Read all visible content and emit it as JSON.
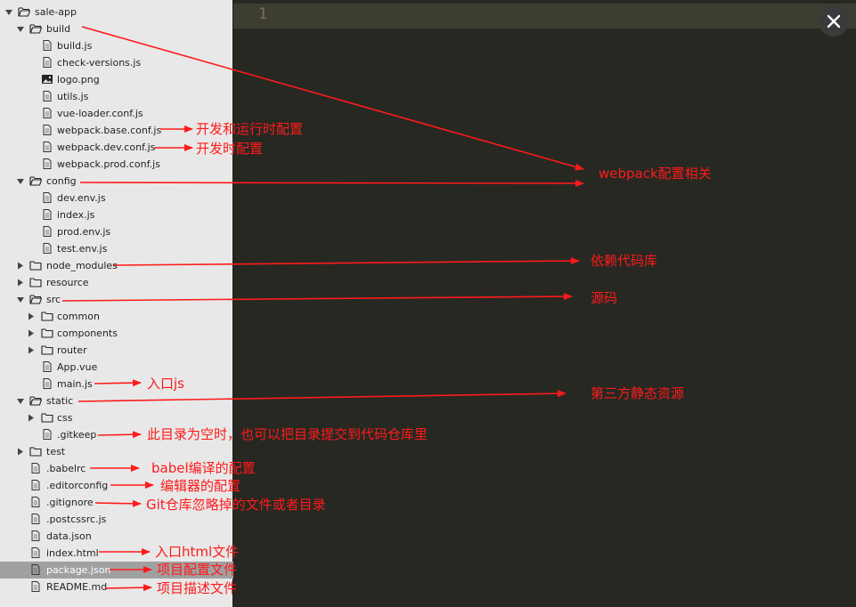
{
  "sidebar": {
    "rows": [
      {
        "label": "sale-app",
        "kind": "folder",
        "open": true,
        "depth": 0
      },
      {
        "label": "build",
        "kind": "folder",
        "open": true,
        "depth": 1
      },
      {
        "label": "build.js",
        "kind": "file",
        "depth": 2
      },
      {
        "label": "check-versions.js",
        "kind": "file",
        "depth": 2
      },
      {
        "label": "logo.png",
        "kind": "image",
        "depth": 2
      },
      {
        "label": "utils.js",
        "kind": "file",
        "depth": 2
      },
      {
        "label": "vue-loader.conf.js",
        "kind": "file",
        "depth": 2
      },
      {
        "label": "webpack.base.conf.js",
        "kind": "file",
        "depth": 2
      },
      {
        "label": "webpack.dev.conf.js",
        "kind": "file",
        "depth": 2
      },
      {
        "label": "webpack.prod.conf.js",
        "kind": "file",
        "depth": 2
      },
      {
        "label": "config",
        "kind": "folder",
        "open": true,
        "depth": 1
      },
      {
        "label": "dev.env.js",
        "kind": "file",
        "depth": 2
      },
      {
        "label": "index.js",
        "kind": "file",
        "depth": 2
      },
      {
        "label": "prod.env.js",
        "kind": "file",
        "depth": 2
      },
      {
        "label": "test.env.js",
        "kind": "file",
        "depth": 2
      },
      {
        "label": "node_modules",
        "kind": "folder",
        "open": false,
        "depth": 1
      },
      {
        "label": "resource",
        "kind": "folder",
        "open": false,
        "depth": 1
      },
      {
        "label": "src",
        "kind": "folder",
        "open": true,
        "depth": 1
      },
      {
        "label": "common",
        "kind": "folder",
        "open": false,
        "depth": 2
      },
      {
        "label": "components",
        "kind": "folder",
        "open": false,
        "depth": 2
      },
      {
        "label": "router",
        "kind": "folder",
        "open": false,
        "depth": 2
      },
      {
        "label": "App.vue",
        "kind": "file",
        "depth": 2
      },
      {
        "label": "main.js",
        "kind": "file",
        "depth": 2
      },
      {
        "label": "static",
        "kind": "folder",
        "open": true,
        "depth": 1
      },
      {
        "label": "css",
        "kind": "folder",
        "open": false,
        "depth": 2
      },
      {
        "label": ".gitkeep",
        "kind": "file",
        "depth": 2
      },
      {
        "label": "test",
        "kind": "folder",
        "open": false,
        "depth": 1
      },
      {
        "label": ".babelrc",
        "kind": "file",
        "depth": 1
      },
      {
        "label": ".editorconfig",
        "kind": "file",
        "depth": 1
      },
      {
        "label": ".gitignore",
        "kind": "file",
        "depth": 1
      },
      {
        "label": ".postcssrc.js",
        "kind": "file",
        "depth": 1
      },
      {
        "label": "data.json",
        "kind": "file",
        "depth": 1
      },
      {
        "label": "index.html",
        "kind": "file",
        "depth": 1
      },
      {
        "label": "package.json",
        "kind": "file",
        "depth": 1,
        "selected": true
      },
      {
        "label": "README.md",
        "kind": "file",
        "depth": 1
      }
    ]
  },
  "editor": {
    "line_number": "1",
    "close_icon": "close-icon"
  },
  "annotations": [
    {
      "id": "webpack-base",
      "text": "开发和运行时配置"
    },
    {
      "id": "webpack-dev",
      "text": "开发时配置"
    },
    {
      "id": "webpack",
      "text": "webpack配置相关"
    },
    {
      "id": "node-modules",
      "text": "依赖代码库"
    },
    {
      "id": "src",
      "text": "源码"
    },
    {
      "id": "main",
      "text": "入口js"
    },
    {
      "id": "static",
      "text": "第三方静态资源"
    },
    {
      "id": "gitkeep",
      "text": "此目录为空时，也可以把目录提交到代码仓库里"
    },
    {
      "id": "babelrc",
      "text": "babel编译的配置"
    },
    {
      "id": "editorconfig",
      "text": "编辑器的配置"
    },
    {
      "id": "gitignore",
      "text": "Git仓库忽略掉的文件或者目录"
    },
    {
      "id": "index-html",
      "text": "入口html文件"
    },
    {
      "id": "package",
      "text": "项目配置文件"
    },
    {
      "id": "readme",
      "text": "项目描述文件"
    }
  ],
  "colors": {
    "annotation": "#ff1a1a",
    "sidebar_bg": "#e8e8e8",
    "editor_bg": "#272822",
    "selected_row": "#a0a0a0"
  }
}
